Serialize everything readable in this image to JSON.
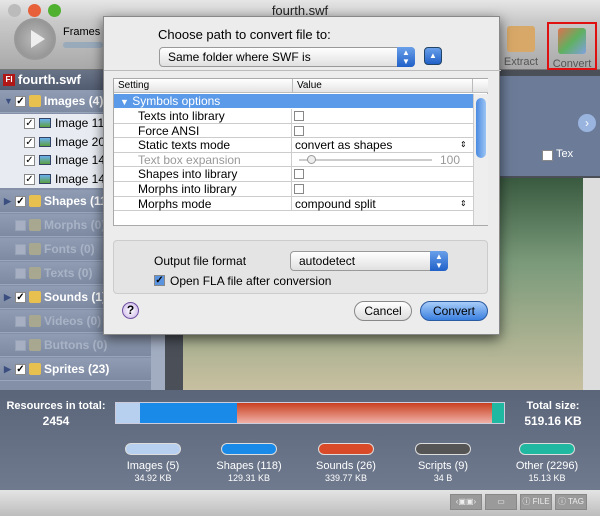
{
  "window": {
    "title": "fourth.swf"
  },
  "toolbar": {
    "frames_label": "Frames",
    "extract_label": "Extract",
    "convert_label": "Convert"
  },
  "sidebar": {
    "root": "fourth.swf",
    "groups": [
      {
        "label": "Images (4)",
        "checked": true,
        "enabled": true,
        "expanded": true,
        "items": [
          "Image 11",
          "Image 20",
          "Image 14",
          "Image 14"
        ]
      },
      {
        "label": "Shapes (11",
        "checked": true,
        "enabled": true
      },
      {
        "label": "Morphs (0)",
        "checked": false,
        "enabled": false
      },
      {
        "label": "Fonts (0)",
        "checked": false,
        "enabled": false
      },
      {
        "label": "Texts (0)",
        "checked": false,
        "enabled": false
      },
      {
        "label": "Sounds (1)",
        "checked": true,
        "enabled": true
      },
      {
        "label": "Videos (0)",
        "checked": false,
        "enabled": false
      },
      {
        "label": "Buttons (0)",
        "checked": false,
        "enabled": false
      },
      {
        "label": "Sprites (23)",
        "checked": true,
        "enabled": true
      }
    ]
  },
  "preview": {
    "thumb_label": "Tex"
  },
  "dialog": {
    "path_label": "Choose path to convert file to:",
    "path_value": "Same folder where SWF is",
    "table": {
      "col_setting": "Setting",
      "col_value": "Value",
      "group": "Symbols options",
      "rows": [
        {
          "setting": "Texts into library",
          "type": "checkbox",
          "checked": false
        },
        {
          "setting": "Force ANSI",
          "type": "checkbox",
          "checked": false
        },
        {
          "setting": "Static texts mode",
          "type": "select",
          "value": "convert as shapes"
        },
        {
          "setting": "Text box expansion",
          "type": "slider",
          "value": "100",
          "disabled": true
        },
        {
          "setting": "Shapes into library",
          "type": "checkbox",
          "checked": false
        },
        {
          "setting": "Morphs into library",
          "type": "checkbox",
          "checked": false
        },
        {
          "setting": "Morphs mode",
          "type": "select",
          "value": "compound split"
        }
      ]
    },
    "output_label": "Output file format",
    "output_value": "autodetect",
    "open_fla_label": "Open FLA file after conversion",
    "open_fla_checked": true,
    "help": "?",
    "cancel": "Cancel",
    "convert": "Convert"
  },
  "summary": {
    "resources_label": "Resources in total:",
    "resources_value": "2454",
    "total_label": "Total size:",
    "total_value": "519.16 KB",
    "legend": [
      {
        "name": "Images (5)",
        "size": "34.92 KB",
        "color": "#b8d0f0"
      },
      {
        "name": "Shapes (118)",
        "size": "129.31 KB",
        "color": "#1a8ae8"
      },
      {
        "name": "Sounds (26)",
        "size": "339.77 KB",
        "color": "#d84a28"
      },
      {
        "name": "Scripts (9)",
        "size": "34 B",
        "color": "#555555"
      },
      {
        "name": "Other (2296)",
        "size": "15.13 KB",
        "color": "#20b8a0"
      }
    ]
  },
  "statusbar": {
    "file": "FILE",
    "tag": "TAG"
  }
}
